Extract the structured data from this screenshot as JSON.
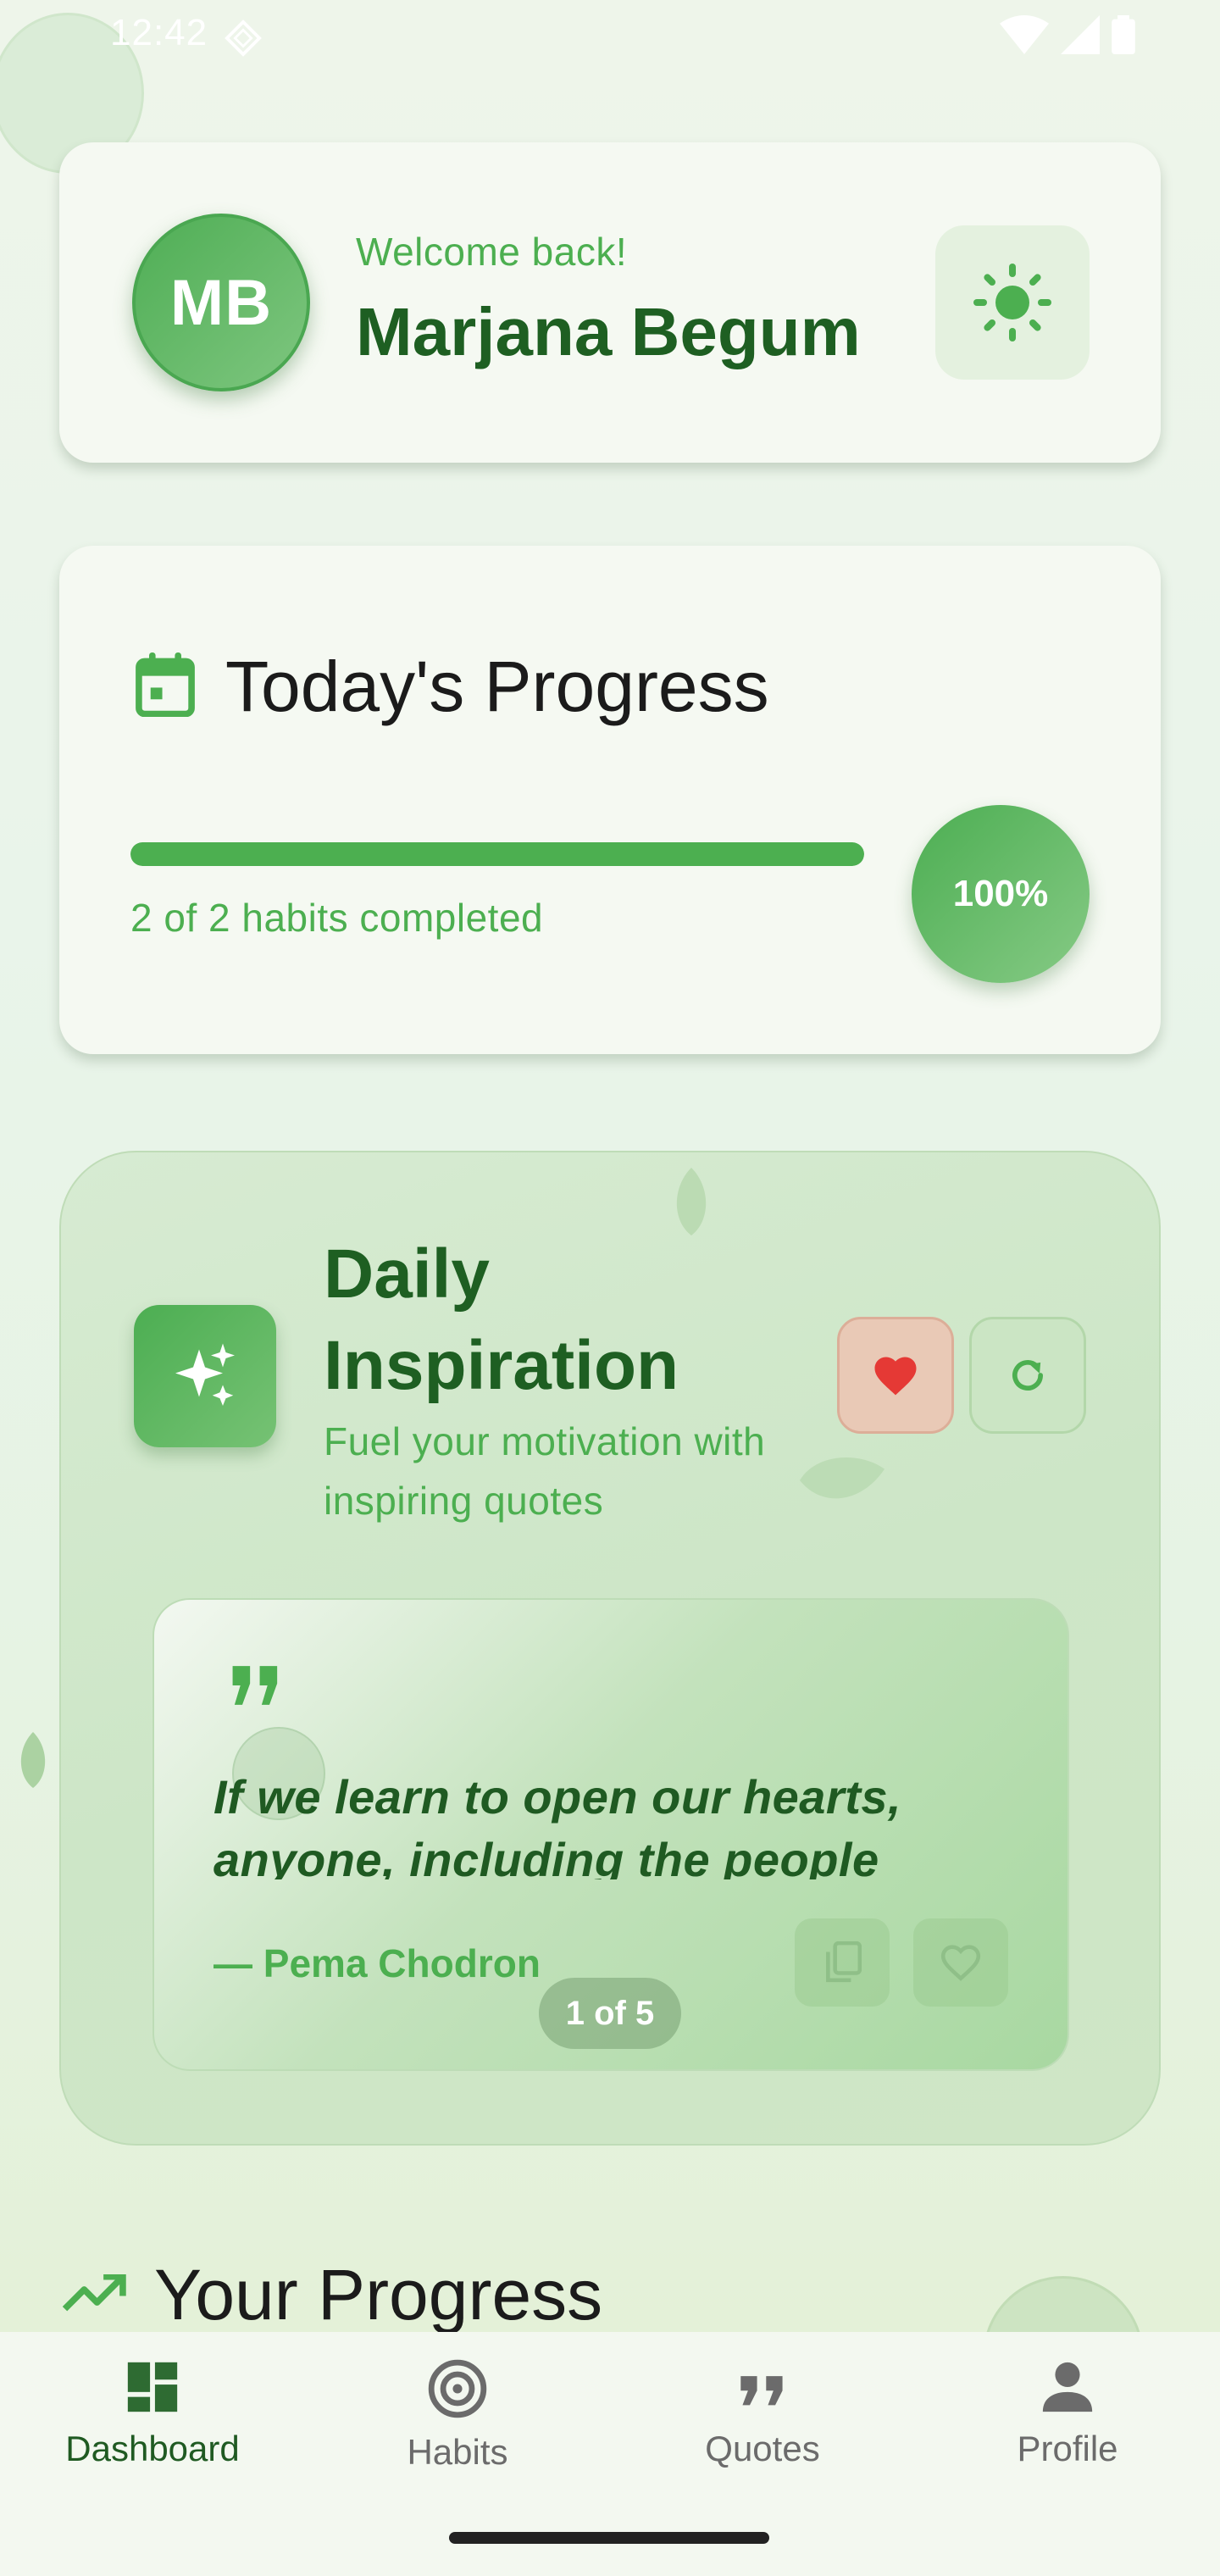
{
  "status_bar": {
    "time": "12:42"
  },
  "header": {
    "avatar_initials": "MB",
    "greeting": "Welcome back!",
    "user_name": "Marjana Begum",
    "theme_icon": "sun-icon"
  },
  "today_progress": {
    "title": "Today's Progress",
    "completed_fraction": 1.0,
    "summary": "2 of 2 habits completed",
    "percent_label": "100%"
  },
  "daily_inspiration": {
    "title": "Daily Inspiration",
    "subtitle": "Fuel your motivation with inspiring quotes",
    "quote": {
      "text": "If we learn to open our hearts, anyone, including the people who",
      "author": "— Pema Chodron"
    },
    "pager": "1 of 5"
  },
  "your_progress": {
    "title": "Your Progress"
  },
  "bottom_nav": {
    "items": [
      {
        "label": "Dashboard",
        "icon": "dashboard-icon"
      },
      {
        "label": "Habits",
        "icon": "target-icon"
      },
      {
        "label": "Quotes",
        "icon": "quote-icon"
      },
      {
        "label": "Profile",
        "icon": "person-icon"
      }
    ],
    "active": "Dashboard"
  },
  "colors": {
    "primary": "#4caf50",
    "primary_dark": "#1e5f22",
    "heart": "#e53935"
  }
}
